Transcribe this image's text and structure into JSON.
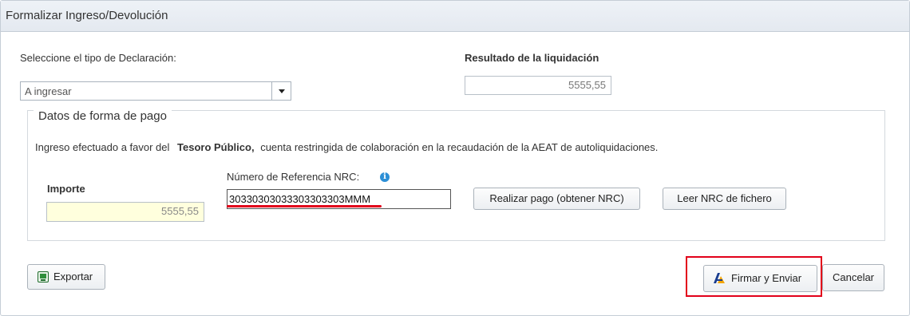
{
  "dialog": {
    "title": "Formalizar Ingreso/Devolución"
  },
  "declaration": {
    "label": "Seleccione el tipo de Declaración:",
    "selected": "A ingresar"
  },
  "result": {
    "label": "Resultado de la liquidación",
    "value": "5555,55"
  },
  "payment": {
    "legend": "Datos de forma de pago",
    "info_prefix": "Ingreso efectuado a favor del",
    "info_bold": "Tesoro Público,",
    "info_suffix": "cuenta restringida de colaboración en la recaudación de la AEAT de autoliquidaciones.",
    "importe_label": "Importe",
    "importe_value": "5555,55",
    "nrc_label": "Número de Referencia  NRC:",
    "nrc_value": "30330303033303303303MMM",
    "realizar_pago_label": "Realizar pago (obtener NRC)",
    "leer_nrc_label": "Leer NRC de fichero"
  },
  "footer": {
    "export_label": "Exportar",
    "firmar_label": "Firmar y Enviar",
    "cancel_label": "Cancelar"
  },
  "colors": {
    "highlight": "#e2001a",
    "importe_bg": "#ffffdd",
    "info_icon": "#2c8fd6"
  },
  "icons": {
    "info": "info-circle-icon",
    "export": "export-icon",
    "firmar": "signature-icon",
    "select_arrow": "caret-down-icon"
  }
}
